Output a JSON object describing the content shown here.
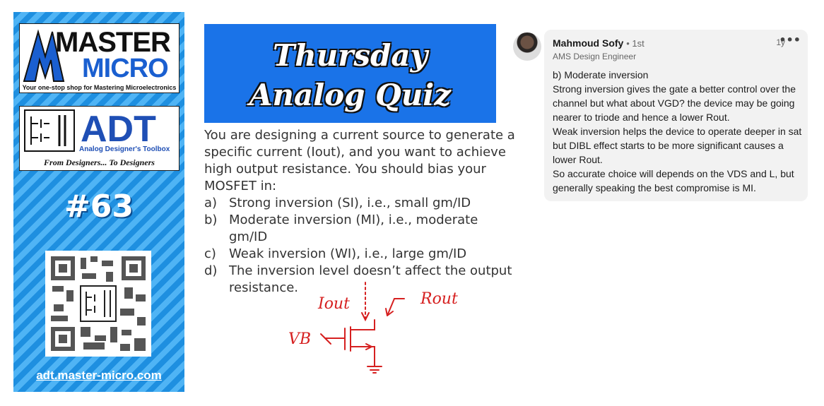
{
  "banner": {
    "logo1_big": "MASTER",
    "logo1_sub": "MICRO",
    "logo1_tag": "Your one-stop shop for Mastering Microelectronics",
    "logo2_big": "ADT",
    "logo2_sub": "Analog Designer's Toolbox",
    "logo2_motto": "From Designers... To Designers",
    "number": "#63",
    "site": "adt.master-micro.com"
  },
  "quiz": {
    "title_line1": "Thursday",
    "title_line2": "Analog Quiz",
    "question": "You are designing a current source to generate a specific current (Iout), and you want to achieve high output resistance. You should bias your MOSFET in:",
    "options": [
      {
        "key": "a)",
        "text": "Strong inversion (SI), i.e., small gm/ID"
      },
      {
        "key": "b)",
        "text": "Moderate inversion (MI), i.e., moderate gm/ID"
      },
      {
        "key": "c)",
        "text": "Weak inversion (WI), i.e., large gm/ID"
      },
      {
        "key": "d)",
        "text": "The inversion level doesn’t affect the output resistance."
      }
    ],
    "sketch_labels": {
      "iout": "Iout",
      "rout": "Rout",
      "vb": "VB"
    }
  },
  "comment": {
    "author": "Mahmoud Sofy",
    "degree": "• 1st",
    "headline": "AMS Design Engineer",
    "time": "1y",
    "more": "•••",
    "body": [
      "b) Moderate inversion",
      "Strong inversion gives the gate a better control over the channel but what about VGD? the device may be going nearer to triode and hence a lower Rout.",
      "Weak inversion helps the device to operate deeper in sat but DIBL effect starts to be more significant causes a lower Rout.",
      "So accurate choice will depends on the VDS and L, but generally speaking the best compromise is MI."
    ]
  },
  "colors": {
    "banner_blue": "#1e8fe0",
    "title_blue": "#1a73e8",
    "sketch_red": "#d62020"
  }
}
